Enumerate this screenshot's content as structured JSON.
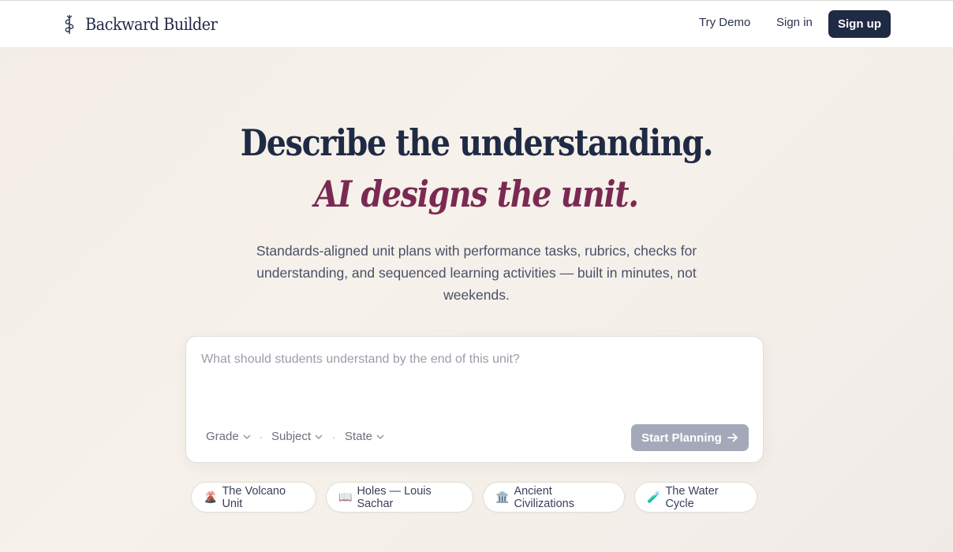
{
  "header": {
    "brand": "Backward Builder",
    "nav": {
      "try_demo": "Try Demo",
      "sign_in": "Sign in",
      "sign_up": "Sign up"
    }
  },
  "hero": {
    "line1": "Describe the understanding.",
    "line2": "AI designs the unit.",
    "subtitle": "Standards-aligned unit plans with performance tasks, rubrics, checks for understanding, and sequenced learning activities — built in minutes, not weekends."
  },
  "prompt": {
    "placeholder": "What should students understand by the end of this unit?",
    "selects": {
      "grade": "Grade",
      "subject": "Subject",
      "state": "State"
    },
    "submit": "Start Planning"
  },
  "examples": [
    {
      "emoji": "🌋",
      "label": "The Volcano Unit"
    },
    {
      "emoji": "📖",
      "label": "Holes — Louis Sachar"
    },
    {
      "emoji": "🏛️",
      "label": "Ancient Civilizations"
    },
    {
      "emoji": "🧪",
      "label": "The Water Cycle"
    }
  ],
  "colors": {
    "navy": "#1f2a44",
    "accent": "#7a2a52",
    "button_disabled": "#a3a9b8"
  }
}
